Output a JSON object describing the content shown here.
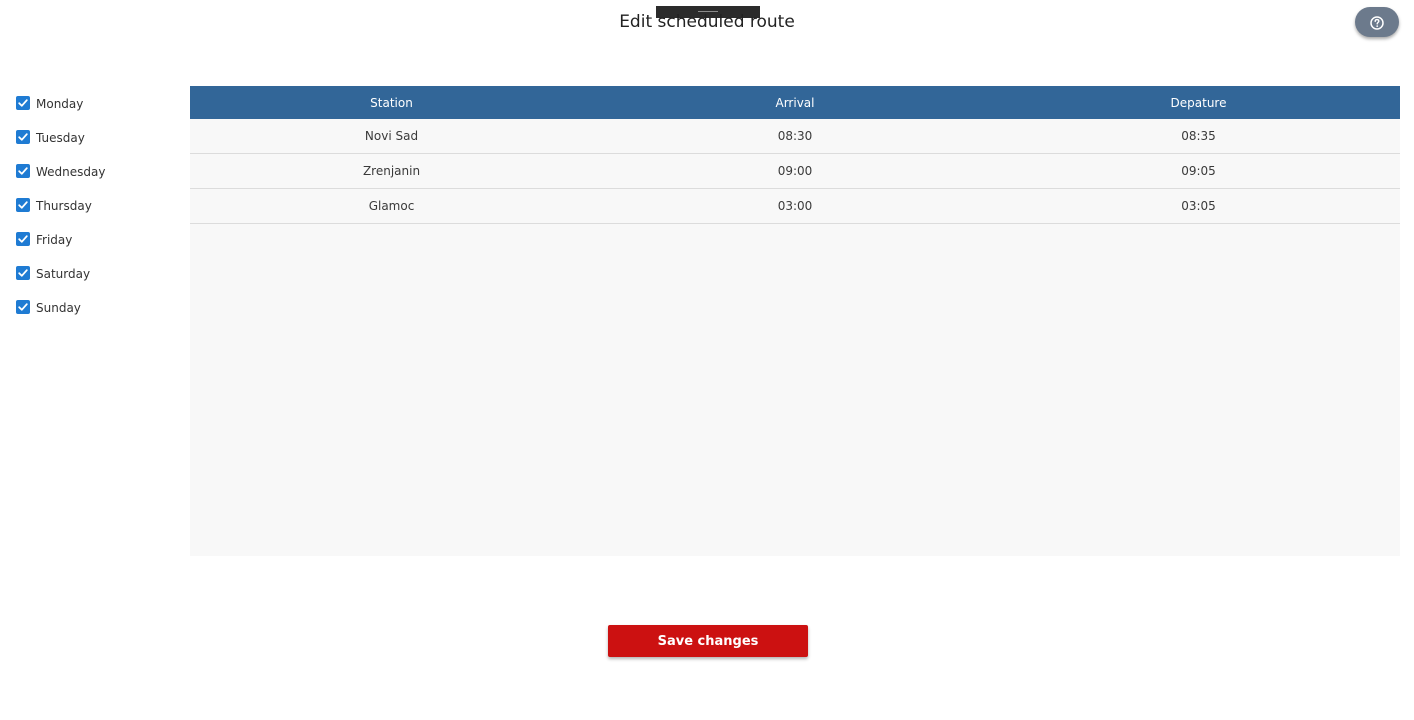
{
  "header": {
    "title": "Edit scheduled route",
    "help_icon": "help-icon"
  },
  "days": [
    {
      "label": "Monday",
      "checked": true
    },
    {
      "label": "Tuesday",
      "checked": true
    },
    {
      "label": "Wednesday",
      "checked": true
    },
    {
      "label": "Thursday",
      "checked": true
    },
    {
      "label": "Friday",
      "checked": true
    },
    {
      "label": "Saturday",
      "checked": true
    },
    {
      "label": "Sunday",
      "checked": true
    }
  ],
  "table": {
    "columns": [
      "Station",
      "Arrival",
      "Depature"
    ],
    "rows": [
      [
        "Novi Sad",
        "08:30",
        "08:35"
      ],
      [
        "Zrenjanin",
        "09:00",
        "09:05"
      ],
      [
        "Glamoc",
        "03:00",
        "03:05"
      ]
    ]
  },
  "actions": {
    "save_label": "Save changes"
  },
  "colors": {
    "table_header": "#326698",
    "checkbox": "#1f7bd3",
    "save_button": "#cc1111",
    "help_button": "#6c7a8c"
  }
}
